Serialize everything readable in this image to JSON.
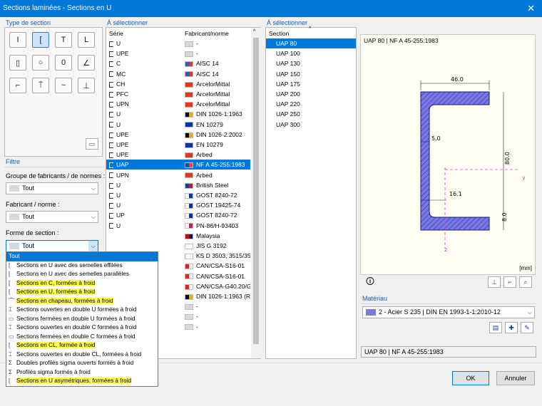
{
  "window": {
    "title": "Sections laminées - Sections en U",
    "close": "✕"
  },
  "type_section": {
    "header": "Type de section",
    "buttons": [
      {
        "glyph": "I",
        "name": "i-section-icon",
        "sel": false
      },
      {
        "glyph": "[",
        "name": "u-section-icon",
        "sel": true
      },
      {
        "glyph": "T",
        "name": "t-section-icon",
        "sel": false
      },
      {
        "glyph": "L",
        "name": "l-section-icon",
        "sel": false
      },
      {
        "glyph": "▯",
        "name": "rect-hollow-icon",
        "sel": false
      },
      {
        "glyph": "○",
        "name": "circle-hollow-icon",
        "sel": false
      },
      {
        "glyph": "0",
        "name": "oval-hollow-icon",
        "sel": false
      },
      {
        "glyph": "∠",
        "name": "z-angle-icon",
        "sel": false
      },
      {
        "glyph": "⌐",
        "name": "z-section-icon",
        "sel": false
      },
      {
        "glyph": "⍑",
        "name": "rail-section-icon",
        "sel": false
      },
      {
        "glyph": "~",
        "name": "sheet-pile-icon",
        "sel": false
      },
      {
        "glyph": "⊥",
        "name": "crane-rail-icon",
        "sel": false
      }
    ]
  },
  "filtre": {
    "header": "Filtre",
    "group_label": "Groupe de fabricants / de normes :",
    "group_value": "Tout",
    "maker_label": "Fabricant / norme :",
    "maker_value": "Tout",
    "form_label": "Forme de section :",
    "form_value": "Tout"
  },
  "series": {
    "header": "À sélectionner",
    "col1": "Série",
    "col2": "Fabricant/norme",
    "rows": [
      {
        "s": "U",
        "m": "-",
        "f": "none",
        "sel": false
      },
      {
        "s": "UPE",
        "m": "-",
        "f": "none",
        "sel": false
      },
      {
        "s": "C",
        "m": "AISC 14",
        "f": "us",
        "sel": false
      },
      {
        "s": "MC",
        "m": "AISC 14",
        "f": "us",
        "sel": false
      },
      {
        "s": "CH",
        "m": "ArcelorMittal",
        "f": "am",
        "sel": false
      },
      {
        "s": "PFC",
        "m": "ArcelorMittal",
        "f": "am",
        "sel": false
      },
      {
        "s": "UPN",
        "m": "ArcelorMittal",
        "f": "am",
        "sel": false
      },
      {
        "s": "U",
        "m": "DIN 1026-1:1963",
        "f": "de",
        "sel": false
      },
      {
        "s": "U",
        "m": "EN 10279",
        "f": "eu",
        "sel": false
      },
      {
        "s": "UPE",
        "m": "DIN 1026-2:2002",
        "f": "de",
        "sel": false
      },
      {
        "s": "UPE",
        "m": "EN 10279",
        "f": "eu",
        "sel": false
      },
      {
        "s": "UPE",
        "m": "Arbed",
        "f": "am",
        "sel": false
      },
      {
        "s": "UAP",
        "m": "NF A 45-255:1983",
        "f": "fr",
        "sel": true
      },
      {
        "s": "UPN",
        "m": "Arbed",
        "f": "am",
        "sel": false
      },
      {
        "s": "U",
        "m": "British Steel",
        "f": "gb",
        "sel": false
      },
      {
        "s": "U",
        "m": "GOST 8240-72",
        "f": "ru",
        "sel": false
      },
      {
        "s": "U",
        "m": "GOST 19425-74",
        "f": "ru",
        "sel": false
      },
      {
        "s": "UP",
        "m": "GOST 8240-72",
        "f": "ru",
        "sel": false
      },
      {
        "s": "U",
        "m": "PN-86/H-93403",
        "f": "pl",
        "sel": false
      },
      {
        "s": "",
        "m": "Malaysia",
        "f": "my",
        "sel": false
      },
      {
        "s": "",
        "m": "JIS G 3192",
        "f": "jp",
        "sel": false
      },
      {
        "s": "",
        "m": "KS D 3503, 3515/35",
        "f": "kr",
        "sel": false
      },
      {
        "s": "",
        "m": "CAN/CSA-S16-01",
        "f": "ca",
        "sel": false
      },
      {
        "s": "",
        "m": "CAN/CSA-S16-01",
        "f": "ca",
        "sel": false
      },
      {
        "s": "",
        "m": "CAN/CSA-G40.20/G",
        "f": "ca",
        "sel": false
      },
      {
        "s": "",
        "m": "DIN 1026-1:1963 (R",
        "f": "de",
        "sel": false
      },
      {
        "s": "",
        "m": "-",
        "f": "none",
        "sel": false
      },
      {
        "s": "",
        "m": "-",
        "f": "none",
        "sel": false
      },
      {
        "s": "",
        "m": "-",
        "f": "none",
        "sel": false
      }
    ]
  },
  "sections": {
    "header": "À sélectionner",
    "col": "Section",
    "rows": [
      "UAP 80",
      "UAP 100",
      "UAP 130",
      "UAP 150",
      "UAP 175",
      "UAP 200",
      "UAP 220",
      "UAP 250",
      "UAP 300"
    ],
    "selected": 0
  },
  "preview": {
    "title": "UAP 80 | NF A 45-255:1983",
    "dim_width": "46.0",
    "dim_web": "5.0",
    "dim_height": "80.0",
    "dim_flange": "8.0",
    "dim_cg": "16.1",
    "axis_y": "y",
    "axis_z": "z",
    "unit": "[mm]",
    "colors": {
      "fill": "#6f6fe0",
      "hatch": "#3a3ab0",
      "axis": "#d040d0"
    }
  },
  "materiau": {
    "header": "Matériau",
    "value": "2 - Acier S 235 | DIN EN 1993-1-1:2010-12",
    "swatch": "#7b7bd8"
  },
  "result": "UAP 80 | NF A 45-255:1983",
  "dropdown": {
    "items": [
      {
        "t": "Tout",
        "i": "",
        "hl": false,
        "sel": true
      },
      {
        "t": "Sections en U avec des semelles effilées",
        "i": "[",
        "hl": false,
        "sel": false
      },
      {
        "t": "Sections en U avec des semelles parallèles",
        "i": "[",
        "hl": false,
        "sel": false
      },
      {
        "t": "Sections en C, formées à froid",
        "i": "[",
        "hl": true,
        "sel": false
      },
      {
        "t": "Sections en U, formées à froid",
        "i": "[",
        "hl": true,
        "sel": false
      },
      {
        "t": "Sections en chapeau, formées à froid",
        "i": "⌒",
        "hl": true,
        "sel": false
      },
      {
        "t": "Sections ouvertes en double U formées à froid",
        "i": "⌶",
        "hl": false,
        "sel": false
      },
      {
        "t": "Sections fermées en double U formées à froid",
        "i": "▭",
        "hl": false,
        "sel": false
      },
      {
        "t": "Sections ouvertes en double C formées à froid",
        "i": "⌶",
        "hl": false,
        "sel": false
      },
      {
        "t": "Sections fermées en double C formées à froid",
        "i": "▭",
        "hl": false,
        "sel": false
      },
      {
        "t": "Sections en CL, formée à froid",
        "i": "[",
        "hl": true,
        "sel": false
      },
      {
        "t": "Sections ouvertes en double CL, formées à froid",
        "i": "⌶",
        "hl": false,
        "sel": false
      },
      {
        "t": "Doubles profilés sigma ouverts formés à froid",
        "i": "Σ",
        "hl": false,
        "sel": false
      },
      {
        "t": "Profilés sigma formés à froid",
        "i": "Σ",
        "hl": false,
        "sel": false
      },
      {
        "t": "Sections en U asymétriques, formées à froid",
        "i": "[",
        "hl": true,
        "sel": false
      }
    ]
  },
  "buttons": {
    "ok": "OK",
    "cancel": "Annuler"
  }
}
